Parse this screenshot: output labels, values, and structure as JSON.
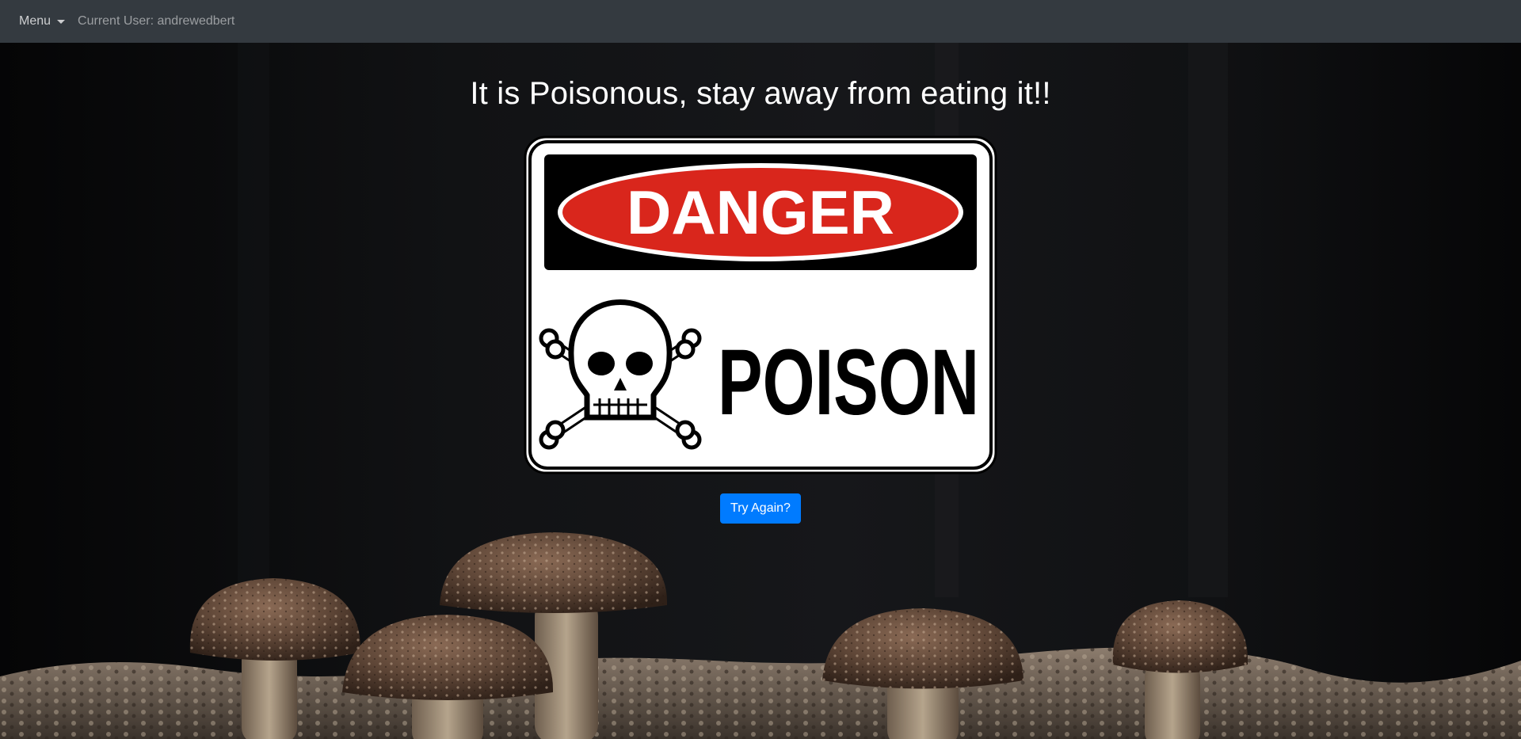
{
  "navbar": {
    "menu_label": "Menu",
    "current_user": "Current User: andrewedbert"
  },
  "main": {
    "heading": "It is Poisonous, stay away from eating it!!",
    "sign": {
      "top_text": "DANGER",
      "bottom_text": "POISON",
      "colors": {
        "red": "#d9261c",
        "black": "#000000",
        "white": "#ffffff"
      }
    },
    "try_again_label": "Try Again?"
  },
  "colors": {
    "navbar_bg": "#343a40",
    "button_bg": "#007bff",
    "page_bg": "#0c0c0d"
  }
}
